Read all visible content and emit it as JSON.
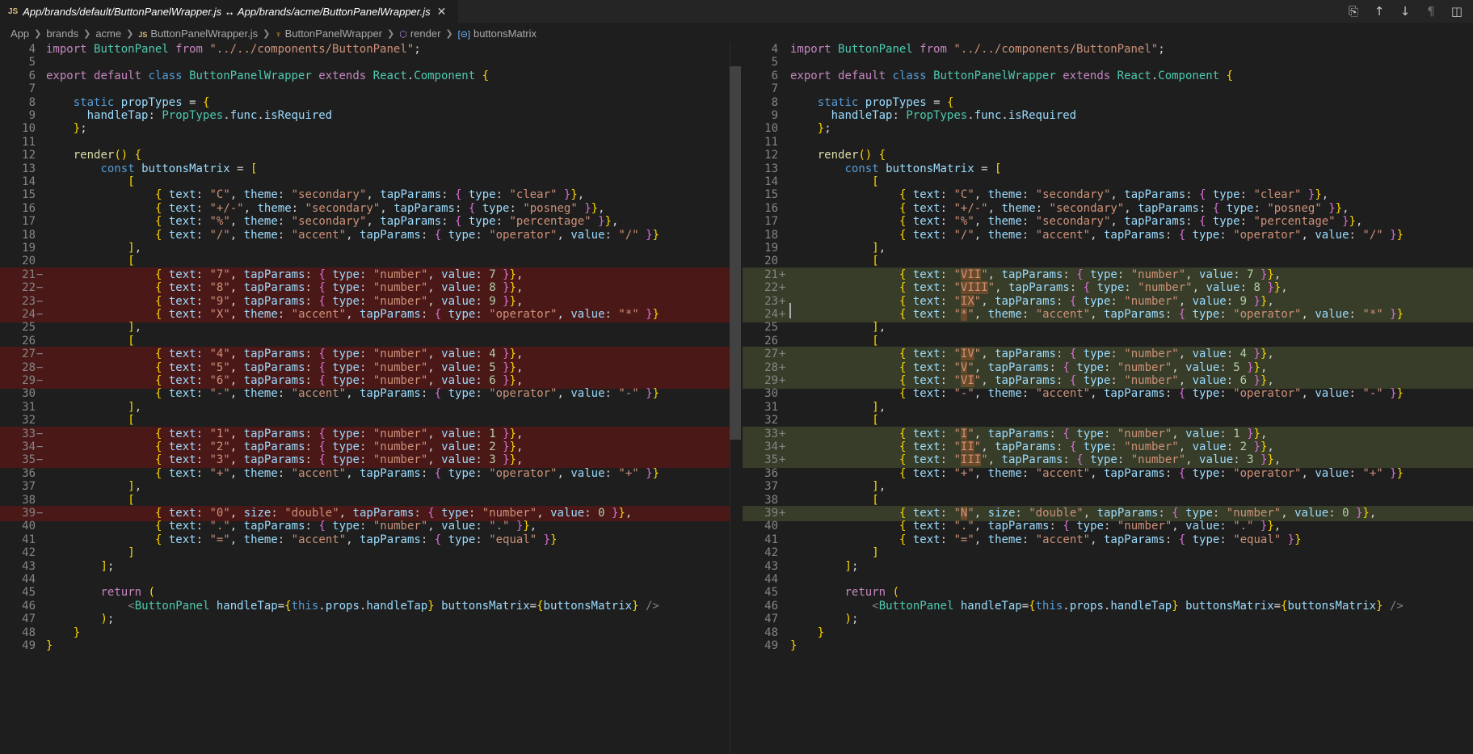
{
  "tab": {
    "icon_label": "JS",
    "title": "App/brands/default/ButtonPanelWrapper.js ↔ App/brands/acme/ButtonPanelWrapper.js",
    "close_glyph": "✕"
  },
  "toolbar": {
    "actions": [
      {
        "name": "open-file-icon",
        "glyph": "⎘"
      },
      {
        "name": "previous-change-icon",
        "glyph": "↑"
      },
      {
        "name": "next-change-icon",
        "glyph": "↓"
      },
      {
        "name": "toggle-whitespace-icon",
        "glyph": "¶"
      },
      {
        "name": "split-editor-icon",
        "glyph": "◫"
      }
    ]
  },
  "breadcrumb": [
    {
      "label": "App",
      "icon": ""
    },
    {
      "label": "brands",
      "icon": ""
    },
    {
      "label": "acme",
      "icon": ""
    },
    {
      "label": "ButtonPanelWrapper.js",
      "icon": "js-icon",
      "glyph": "JS"
    },
    {
      "label": "ButtonPanelWrapper",
      "icon": "class-icon",
      "glyph": "♆"
    },
    {
      "label": "render",
      "icon": "method-icon",
      "glyph": "⬡"
    },
    {
      "label": "buttonsMatrix",
      "icon": "variable-icon",
      "glyph": "[⊝]"
    }
  ],
  "colors": {
    "background": "#1e1e1e",
    "deleted_line": "#4b1818",
    "inserted_line": "#373d29",
    "keyword": "#c586c0",
    "string": "#ce9178"
  },
  "left_pane": {
    "lines": [
      {
        "n": "4",
        "mark": "",
        "type": "",
        "text": "import ButtonPanel from \"../../components/ButtonPanel\";"
      },
      {
        "n": "5",
        "mark": "",
        "type": "",
        "text": ""
      },
      {
        "n": "6",
        "mark": "",
        "type": "",
        "text": "export default class ButtonPanelWrapper extends React.Component {"
      },
      {
        "n": "7",
        "mark": "",
        "type": "",
        "text": ""
      },
      {
        "n": "8",
        "mark": "",
        "type": "",
        "text": "    static propTypes = {"
      },
      {
        "n": "9",
        "mark": "",
        "type": "",
        "text": "      handleTap: PropTypes.func.isRequired"
      },
      {
        "n": "10",
        "mark": "",
        "type": "",
        "text": "    };"
      },
      {
        "n": "11",
        "mark": "",
        "type": "",
        "text": ""
      },
      {
        "n": "12",
        "mark": "",
        "type": "",
        "text": "    render() {"
      },
      {
        "n": "13",
        "mark": "",
        "type": "",
        "text": "        const buttonsMatrix = ["
      },
      {
        "n": "14",
        "mark": "",
        "type": "",
        "text": "            ["
      },
      {
        "n": "15",
        "mark": "",
        "type": "",
        "text": "                { text: \"C\", theme: \"secondary\", tapParams: { type: \"clear\" }},"
      },
      {
        "n": "16",
        "mark": "",
        "type": "",
        "text": "                { text: \"+/-\", theme: \"secondary\", tapParams: { type: \"posneg\" }},"
      },
      {
        "n": "17",
        "mark": "",
        "type": "",
        "text": "                { text: \"%\", theme: \"secondary\", tapParams: { type: \"percentage\" }},"
      },
      {
        "n": "18",
        "mark": "",
        "type": "",
        "text": "                { text: \"/\", theme: \"accent\", tapParams: { type: \"operator\", value: \"/\" }}"
      },
      {
        "n": "19",
        "mark": "",
        "type": "",
        "text": "            ],"
      },
      {
        "n": "20",
        "mark": "",
        "type": "",
        "text": "            ["
      },
      {
        "n": "21",
        "mark": "−",
        "type": "del",
        "text": "                { text: \"7\", tapParams: { type: \"number\", value: 7 }},"
      },
      {
        "n": "22",
        "mark": "−",
        "type": "del",
        "text": "                { text: \"8\", tapParams: { type: \"number\", value: 8 }},"
      },
      {
        "n": "23",
        "mark": "−",
        "type": "del",
        "text": "                { text: \"9\", tapParams: { type: \"number\", value: 9 }},"
      },
      {
        "n": "24",
        "mark": "−",
        "type": "del",
        "text": "                { text: \"X\", theme: \"accent\", tapParams: { type: \"operator\", value: \"*\" }}"
      },
      {
        "n": "25",
        "mark": "",
        "type": "",
        "text": "            ],"
      },
      {
        "n": "26",
        "mark": "",
        "type": "",
        "text": "            ["
      },
      {
        "n": "27",
        "mark": "−",
        "type": "del",
        "text": "                { text: \"4\", tapParams: { type: \"number\", value: 4 }},"
      },
      {
        "n": "28",
        "mark": "−",
        "type": "del",
        "text": "                { text: \"5\", tapParams: { type: \"number\", value: 5 }},"
      },
      {
        "n": "29",
        "mark": "−",
        "type": "del",
        "text": "                { text: \"6\", tapParams: { type: \"number\", value: 6 }},"
      },
      {
        "n": "30",
        "mark": "",
        "type": "",
        "text": "                { text: \"-\", theme: \"accent\", tapParams: { type: \"operator\", value: \"-\" }}"
      },
      {
        "n": "31",
        "mark": "",
        "type": "",
        "text": "            ],"
      },
      {
        "n": "32",
        "mark": "",
        "type": "",
        "text": "            ["
      },
      {
        "n": "33",
        "mark": "−",
        "type": "del",
        "text": "                { text: \"1\", tapParams: { type: \"number\", value: 1 }},"
      },
      {
        "n": "34",
        "mark": "−",
        "type": "del",
        "text": "                { text: \"2\", tapParams: { type: \"number\", value: 2 }},"
      },
      {
        "n": "35",
        "mark": "−",
        "type": "del",
        "text": "                { text: \"3\", tapParams: { type: \"number\", value: 3 }},"
      },
      {
        "n": "36",
        "mark": "",
        "type": "",
        "text": "                { text: \"+\", theme: \"accent\", tapParams: { type: \"operator\", value: \"+\" }}"
      },
      {
        "n": "37",
        "mark": "",
        "type": "",
        "text": "            ],"
      },
      {
        "n": "38",
        "mark": "",
        "type": "",
        "text": "            ["
      },
      {
        "n": "39",
        "mark": "−",
        "type": "del",
        "text": "                { text: \"0\", size: \"double\", tapParams: { type: \"number\", value: 0 }},"
      },
      {
        "n": "40",
        "mark": "",
        "type": "",
        "text": "                { text: \".\", tapParams: { type: \"number\", value: \".\" }},"
      },
      {
        "n": "41",
        "mark": "",
        "type": "",
        "text": "                { text: \"=\", theme: \"accent\", tapParams: { type: \"equal\" }}"
      },
      {
        "n": "42",
        "mark": "",
        "type": "",
        "text": "            ]"
      },
      {
        "n": "43",
        "mark": "",
        "type": "",
        "text": "        ];"
      },
      {
        "n": "44",
        "mark": "",
        "type": "",
        "text": ""
      },
      {
        "n": "45",
        "mark": "",
        "type": "",
        "text": "        return ("
      },
      {
        "n": "46",
        "mark": "",
        "type": "",
        "text": "            <ButtonPanel handleTap={this.props.handleTap} buttonsMatrix={buttonsMatrix} />"
      },
      {
        "n": "47",
        "mark": "",
        "type": "",
        "text": "        );"
      },
      {
        "n": "48",
        "mark": "",
        "type": "",
        "text": "    }"
      },
      {
        "n": "49",
        "mark": "",
        "type": "",
        "text": "}"
      }
    ]
  },
  "right_pane": {
    "lines": [
      {
        "n": "4",
        "mark": "",
        "type": "",
        "text": "import ButtonPanel from \"../../components/ButtonPanel\";"
      },
      {
        "n": "5",
        "mark": "",
        "type": "",
        "text": ""
      },
      {
        "n": "6",
        "mark": "",
        "type": "",
        "text": "export default class ButtonPanelWrapper extends React.Component {"
      },
      {
        "n": "7",
        "mark": "",
        "type": "",
        "text": ""
      },
      {
        "n": "8",
        "mark": "",
        "type": "",
        "text": "    static propTypes = {"
      },
      {
        "n": "9",
        "mark": "",
        "type": "",
        "text": "      handleTap: PropTypes.func.isRequired"
      },
      {
        "n": "10",
        "mark": "",
        "type": "",
        "text": "    };"
      },
      {
        "n": "11",
        "mark": "",
        "type": "",
        "text": ""
      },
      {
        "n": "12",
        "mark": "",
        "type": "",
        "text": "    render() {"
      },
      {
        "n": "13",
        "mark": "",
        "type": "",
        "text": "        const buttonsMatrix = ["
      },
      {
        "n": "14",
        "mark": "",
        "type": "",
        "text": "            ["
      },
      {
        "n": "15",
        "mark": "",
        "type": "",
        "text": "                { text: \"C\", theme: \"secondary\", tapParams: { type: \"clear\" }},"
      },
      {
        "n": "16",
        "mark": "",
        "type": "",
        "text": "                { text: \"+/-\", theme: \"secondary\", tapParams: { type: \"posneg\" }},"
      },
      {
        "n": "17",
        "mark": "",
        "type": "",
        "text": "                { text: \"%\", theme: \"secondary\", tapParams: { type: \"percentage\" }},"
      },
      {
        "n": "18",
        "mark": "",
        "type": "",
        "text": "                { text: \"/\", theme: \"accent\", tapParams: { type: \"operator\", value: \"/\" }}"
      },
      {
        "n": "19",
        "mark": "",
        "type": "",
        "text": "            ],"
      },
      {
        "n": "20",
        "mark": "",
        "type": "",
        "text": "            ["
      },
      {
        "n": "21",
        "mark": "+",
        "type": "add",
        "text": "                { text: \"VII\", tapParams: { type: \"number\", value: 7 }},"
      },
      {
        "n": "22",
        "mark": "+",
        "type": "add",
        "text": "                { text: \"VIII\", tapParams: { type: \"number\", value: 8 }},"
      },
      {
        "n": "23",
        "mark": "+",
        "type": "add",
        "text": "                { text: \"IX\", tapParams: { type: \"number\", value: 9 }},"
      },
      {
        "n": "24",
        "mark": "+",
        "type": "add",
        "text": "                { text: \"*\", theme: \"accent\", tapParams: { type: \"operator\", value: \"*\" }}"
      },
      {
        "n": "25",
        "mark": "",
        "type": "",
        "text": "            ],"
      },
      {
        "n": "26",
        "mark": "",
        "type": "",
        "text": "            ["
      },
      {
        "n": "27",
        "mark": "+",
        "type": "add",
        "text": "                { text: \"IV\", tapParams: { type: \"number\", value: 4 }},"
      },
      {
        "n": "28",
        "mark": "+",
        "type": "add",
        "text": "                { text: \"V\", tapParams: { type: \"number\", value: 5 }},"
      },
      {
        "n": "29",
        "mark": "+",
        "type": "add",
        "text": "                { text: \"VI\", tapParams: { type: \"number\", value: 6 }},"
      },
      {
        "n": "30",
        "mark": "",
        "type": "",
        "text": "                { text: \"-\", theme: \"accent\", tapParams: { type: \"operator\", value: \"-\" }}"
      },
      {
        "n": "31",
        "mark": "",
        "type": "",
        "text": "            ],"
      },
      {
        "n": "32",
        "mark": "",
        "type": "",
        "text": "            ["
      },
      {
        "n": "33",
        "mark": "+",
        "type": "add",
        "text": "                { text: \"I\", tapParams: { type: \"number\", value: 1 }},"
      },
      {
        "n": "34",
        "mark": "+",
        "type": "add",
        "text": "                { text: \"II\", tapParams: { type: \"number\", value: 2 }},"
      },
      {
        "n": "35",
        "mark": "+",
        "type": "add",
        "text": "                { text: \"III\", tapParams: { type: \"number\", value: 3 }},"
      },
      {
        "n": "36",
        "mark": "",
        "type": "",
        "text": "                { text: \"+\", theme: \"accent\", tapParams: { type: \"operator\", value: \"+\" }}"
      },
      {
        "n": "37",
        "mark": "",
        "type": "",
        "text": "            ],"
      },
      {
        "n": "38",
        "mark": "",
        "type": "",
        "text": "            ["
      },
      {
        "n": "39",
        "mark": "+",
        "type": "add",
        "text": "                { text: \"N\", size: \"double\", tapParams: { type: \"number\", value: 0 }},"
      },
      {
        "n": "40",
        "mark": "",
        "type": "",
        "text": "                { text: \".\", tapParams: { type: \"number\", value: \".\" }},"
      },
      {
        "n": "41",
        "mark": "",
        "type": "",
        "text": "                { text: \"=\", theme: \"accent\", tapParams: { type: \"equal\" }}"
      },
      {
        "n": "42",
        "mark": "",
        "type": "",
        "text": "            ]"
      },
      {
        "n": "43",
        "mark": "",
        "type": "",
        "text": "        ];"
      },
      {
        "n": "44",
        "mark": "",
        "type": "",
        "text": ""
      },
      {
        "n": "45",
        "mark": "",
        "type": "",
        "text": "        return ("
      },
      {
        "n": "46",
        "mark": "",
        "type": "",
        "text": "            <ButtonPanel handleTap={this.props.handleTap} buttonsMatrix={buttonsMatrix} />"
      },
      {
        "n": "47",
        "mark": "",
        "type": "",
        "text": "        );"
      },
      {
        "n": "48",
        "mark": "",
        "type": "",
        "text": "    }"
      },
      {
        "n": "49",
        "mark": "",
        "type": "",
        "text": "}"
      }
    ]
  }
}
